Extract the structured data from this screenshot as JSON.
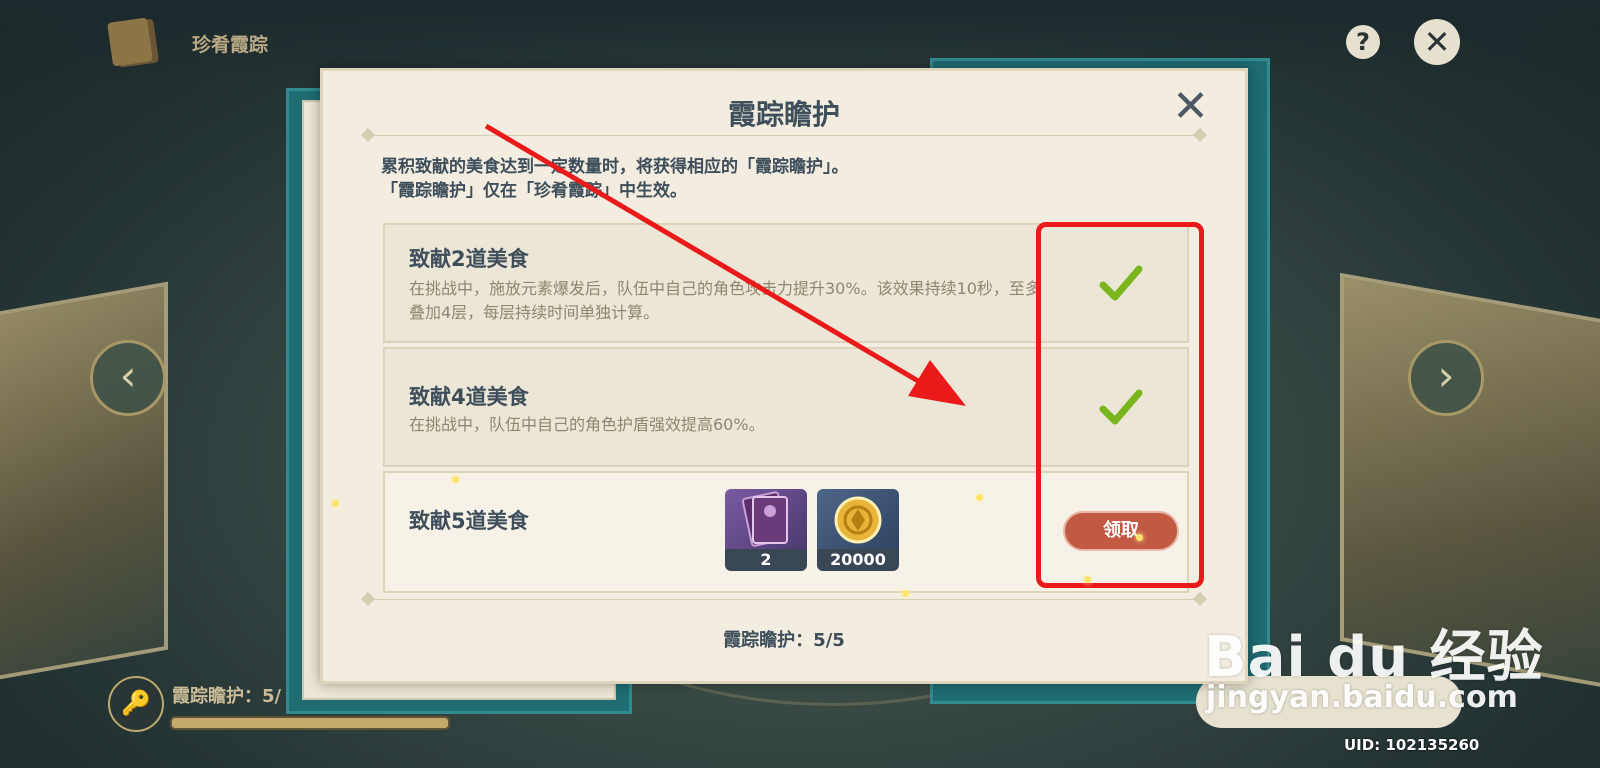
{
  "app": {
    "header_title": "珍肴霞踪",
    "help_label": "?",
    "close_label": "✕"
  },
  "dialog": {
    "title": "霞踪瞻护",
    "close_label": "✕",
    "description": [
      "累积致献的美食达到一定数量时，将获得相应的「霞踪瞻护」。",
      "「霞踪瞻护」仅在「珍肴霞踪」中生效。"
    ],
    "tiers": [
      {
        "title": "致献2道美食",
        "description": "在挑战中，施放元素爆发后，队伍中自己的角色攻击力提升30%。该效果持续10秒，至多叠加4层，每层持续时间单独计算。",
        "status": "completed",
        "status_icon": "check-icon"
      },
      {
        "title": "致献4道美食",
        "description": "在挑战中，队伍中自己的角色护盾强效提高60%。",
        "status": "completed",
        "status_icon": "check-icon"
      },
      {
        "title": "致献5道美食",
        "rewards": [
          {
            "icon": "book-icon",
            "quantity": "2"
          },
          {
            "icon": "mora-coin-icon",
            "quantity": "20000"
          }
        ],
        "claim_label": "领取"
      }
    ],
    "footer": "霞踪瞻护：5/5"
  },
  "bottom": {
    "meter_label": "霞踪瞻护：5/",
    "uid": "UID: 102135260"
  },
  "watermark": {
    "logo": "Bai du 经验",
    "url": "jingyan.baidu.com"
  },
  "colors": {
    "annotation_red": "#ea1a1a",
    "check_green": "#7ab51d",
    "claim_button": "#c25a43",
    "dialog_bg": "#f2ede0",
    "title_text": "#3f4e5b"
  }
}
